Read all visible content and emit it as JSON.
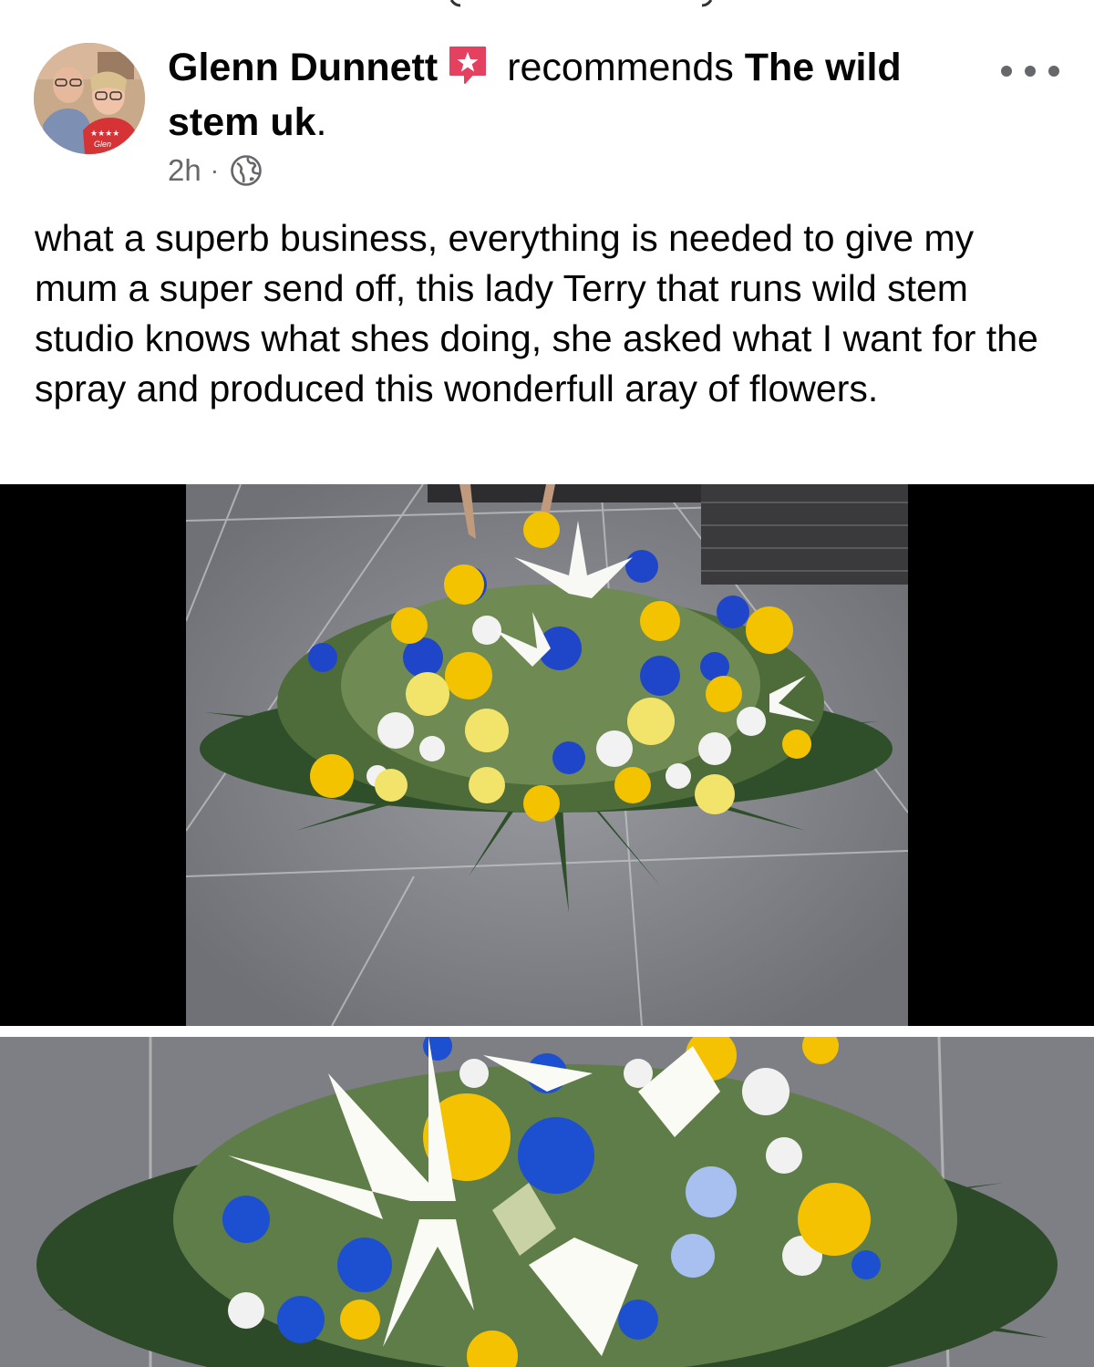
{
  "post": {
    "author_name": "Glenn Dunnett",
    "action_text": "recommends",
    "page_name_line1": "The wild",
    "page_name_line2": "stem uk",
    "page_name_end": ".",
    "time_ago": "2h",
    "separator": "·",
    "audience_icon": "globe-icon",
    "badge_icon": "recommendation-star-icon",
    "more_icon": "more-options-icon",
    "body": "what a superb business, everything is needed to give my mum a super send off, this lady Terry that runs wild stem studio knows what shes doing, she asked what I want for the spray and produced this wonderfull aray of flowers."
  },
  "colors": {
    "badge": "#e4405f",
    "secondary_text": "#65676b",
    "primary_text": "#050505"
  },
  "media": {
    "photo_count_visible": 2
  }
}
